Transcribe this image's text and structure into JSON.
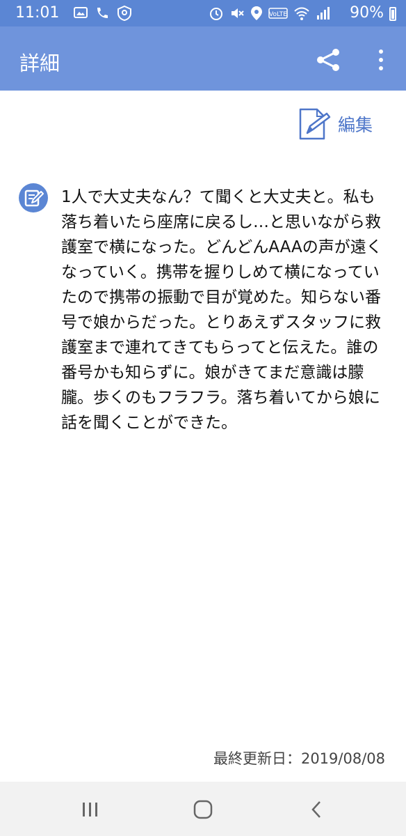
{
  "status_bar": {
    "time": "11:01",
    "battery_percent": "90%",
    "left_icons": [
      "image-icon",
      "call-forward-icon",
      "vpn-icon"
    ],
    "right_icons": [
      "alarm-icon",
      "mute-icon",
      "location-icon",
      "volte-icon",
      "wifi-icon",
      "signal-icon",
      "battery-icon"
    ]
  },
  "app_bar": {
    "title": "詳細",
    "share_icon": "share-icon",
    "more_icon": "more-vertical-icon",
    "color": "#6f94dc"
  },
  "edit": {
    "label": "編集",
    "icon": "edit-document-icon"
  },
  "memo": {
    "icon": "memo-icon",
    "text": "1人で大丈夫なん？て聞くと大丈夫と。私も落ち着いたら座席に戻るし…と思いながら救護室で横になった。どんどんAAAの声が遠くなっていく。携帯を握りしめて横になっていたので携帯の振動で目が覚めた。知らない番号で娘からだった。とりあえずスタッフに救護室まで連れてきてもらってと伝えた。誰の番号かも知らずに。娘がきてまだ意識は朦朧。歩くのもフラフラ。落ち着いてから娘に話を聞くことができた。"
  },
  "footer": {
    "last_updated": "最終更新日：2019/08/08"
  },
  "nav_bar": {
    "recents_icon": "recents-icon",
    "home_icon": "home-icon",
    "back_icon": "back-icon"
  }
}
